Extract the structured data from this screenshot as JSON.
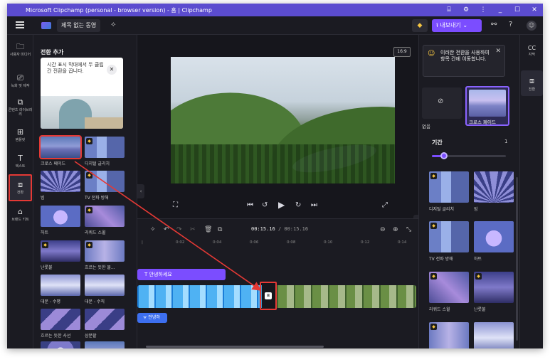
{
  "window": {
    "title": "Microsoft Clipchamp (personal - browser version) - 홈 | Clipchamp",
    "controls": [
      "⌸",
      "⚙",
      "⋮",
      "_",
      "☐",
      "✕"
    ]
  },
  "topbar": {
    "project_name": "제목 없는 동영",
    "export_label": "⭱ 내보내기 ⌄"
  },
  "left_rail": [
    {
      "label": "사용자 미디어",
      "icon": "folder-icon",
      "glyph": "🗀"
    },
    {
      "label": "녹화 및 제작",
      "icon": "camera-icon",
      "glyph": "⎚"
    },
    {
      "label": "콘텐츠 라이브러리",
      "icon": "library-icon",
      "glyph": "⧉"
    },
    {
      "label": "템플릿",
      "icon": "template-icon",
      "glyph": "⊞"
    },
    {
      "label": "텍스트",
      "icon": "text-icon",
      "glyph": "T"
    },
    {
      "label": "전환",
      "icon": "transitions-icon",
      "glyph": "⧈"
    },
    {
      "label": "브랜드 키트",
      "icon": "brand-kit-icon",
      "glyph": "⌂"
    }
  ],
  "library": {
    "title": "전환 추가",
    "tip_text": "시간 표시 막대에서 두 클립 간 전환을 끕니다.",
    "tiles": [
      {
        "label": "크로스 페이드",
        "premium": false,
        "selected": true
      },
      {
        "label": "디지털 글리치",
        "premium": true,
        "selected": false
      },
      {
        "label": "빔",
        "premium": false,
        "selected": false
      },
      {
        "label": "TV 전파 방해",
        "premium": true,
        "selected": false
      },
      {
        "label": "하트",
        "premium": false,
        "selected": false
      },
      {
        "label": "리퀴드 스윌",
        "premium": true,
        "selected": false
      },
      {
        "label": "난롯불",
        "premium": true,
        "selected": false
      },
      {
        "label": "흐르는 듯한 물...",
        "premium": true,
        "selected": false
      },
      {
        "label": "대문 - 수평",
        "premium": false,
        "selected": false
      },
      {
        "label": "대문 - 수직",
        "premium": false,
        "selected": false
      },
      {
        "label": "흐르는 듯한 사선",
        "premium": false,
        "selected": false
      },
      {
        "label": "삼분할",
        "premium": false,
        "selected": false
      }
    ]
  },
  "preview": {
    "aspect_ratio": "16:9"
  },
  "timeline": {
    "current_time": "00:15.16",
    "total_time": "/ 00:15.16",
    "ruler": [
      "0:02",
      "0:04",
      "0:06",
      "0:08",
      "0:10",
      "0:12",
      "0:14"
    ],
    "text_clip": "T  안녕하세요",
    "audio_clip": "ᯤ 안녕하",
    "transition_marker": "⧈"
  },
  "right_panel": {
    "tip_text": "이러한 전환을 사용하여 항목 간에 이동합니다.",
    "none_label": "없음",
    "crossfade_label": "크로스 페이드",
    "duration_label": "기간",
    "duration_value": "1",
    "duration_fraction": 0.16,
    "tiles": [
      {
        "label": "디지털 글리치",
        "premium": true
      },
      {
        "label": "빔",
        "premium": false
      },
      {
        "label": "TV 전파 방해",
        "premium": true
      },
      {
        "label": "하트",
        "premium": false
      },
      {
        "label": "리퀴드 스윌",
        "premium": true
      },
      {
        "label": "난롯불",
        "premium": true
      },
      {
        "label": "",
        "premium": true
      },
      {
        "label": "",
        "premium": false
      }
    ]
  },
  "right_rail": [
    {
      "label": "자막",
      "icon": "captions-icon",
      "glyph": "CC"
    },
    {
      "label": "전환",
      "icon": "transitions-icon",
      "glyph": "⧈"
    }
  ],
  "colors": {
    "accent": "#7b4dff",
    "titlebar": "#5b4ccf",
    "highlight": "#e53935",
    "audio": "#3d6ff0"
  }
}
